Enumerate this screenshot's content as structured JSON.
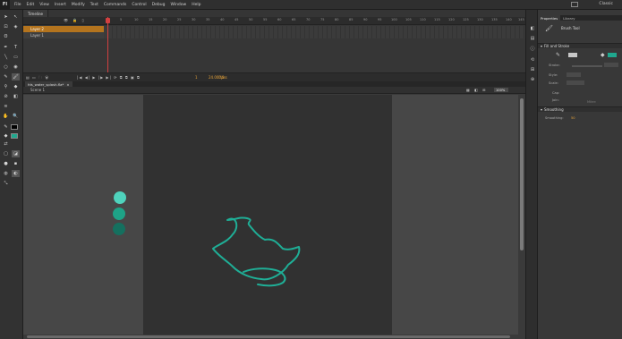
{
  "app": {
    "logo": "Fl",
    "workspace": "Classic"
  },
  "menu": [
    "File",
    "Edit",
    "View",
    "Insert",
    "Modify",
    "Text",
    "Commands",
    "Control",
    "Debug",
    "Window",
    "Help"
  ],
  "timeline": {
    "tab": "Timeline",
    "header_icons": "👁 🔒 ▯",
    "ruler": [
      "1",
      "5",
      "10",
      "15",
      "20",
      "25",
      "30",
      "35",
      "40",
      "45",
      "50",
      "55",
      "60",
      "65",
      "70",
      "75",
      "80",
      "85",
      "90",
      "95",
      "100",
      "105",
      "110",
      "115",
      "120",
      "125",
      "130",
      "135",
      "140",
      "145"
    ],
    "layers": [
      {
        "name": "Layer 2"
      },
      {
        "name": "Layer 1"
      }
    ],
    "footer_controls": "▤ ▭ 🗀 🗑",
    "playback_controls": "|◀ ◀| ▶ |▶ ▶| ⟳ ⧉ ⧉ ▣ ⧉",
    "current_frame": "1",
    "fps": "24.00 fps",
    "time": "0.0 s"
  },
  "document": {
    "tab": "fds_water_splash.fla*",
    "close": "×",
    "scene": "Scene 1",
    "edit_icons": "▦ ◧ ⊞",
    "zoom": "100%"
  },
  "stage_art": {
    "dots": [
      "#4fd3bd",
      "#1ea387",
      "#15705f"
    ],
    "splash_color": "#1fae96"
  },
  "properties": {
    "tabs": [
      "Properties",
      "Library"
    ],
    "tool_name": "Brush Tool",
    "fill_stroke": {
      "title": "Fill and Stroke",
      "stroke_color": "#c8c8c8",
      "fill_color": "#1fa88e",
      "rows": [
        "Stroke:",
        "Style:",
        "Scale:",
        "Cap:",
        "Join:"
      ],
      "miter_label": "Miter:"
    },
    "smoothing": {
      "title": "Smoothing",
      "label": "Smoothing:",
      "value": "50"
    }
  }
}
